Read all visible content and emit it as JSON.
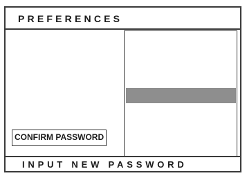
{
  "header": {
    "title": "PREFERENCES"
  },
  "left_pane": {
    "confirm_label": "CONFIRM PASSWORD"
  },
  "right_pane": {
    "selected_row_color": "#8e8e8e"
  },
  "footer": {
    "prompt": "INPUT NEW PASSWORD"
  }
}
